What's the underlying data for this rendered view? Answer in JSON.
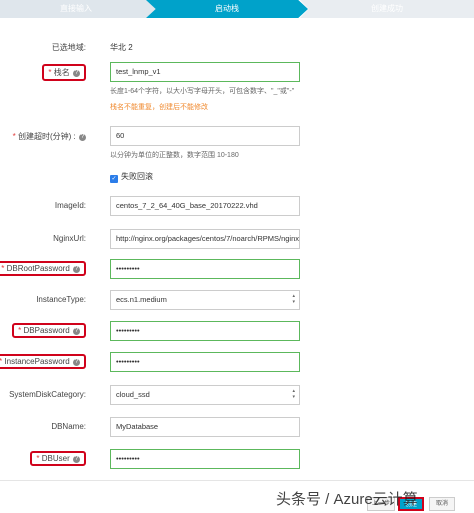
{
  "steps": [
    "直接输入",
    "启动栈",
    "创建成功"
  ],
  "region": {
    "label": "已选地域:",
    "value": "华北 2"
  },
  "stack_name": {
    "label": "栈名",
    "value": "test_lnmp_v1",
    "hint": "长度1-64个字符，以大小写字母开头，可包含数字、\"_\"或\"-\"",
    "warning": "栈名不能重复，创建后不能修改"
  },
  "timeout": {
    "label": "创建超时(分钟)",
    "value": "60",
    "hint": "以分钟为单位的正整数，数字范围 10-180"
  },
  "rollback": {
    "label": "失败回滚",
    "checked": true
  },
  "params": {
    "image_id": {
      "label": "ImageId:",
      "value": "centos_7_2_64_40G_base_20170222.vhd"
    },
    "nginx_url": {
      "label": "NginxUrl:",
      "value": "http://nginx.org/packages/centos/7/noarch/RPMS/nginx"
    },
    "db_root_password": {
      "label": "DBRootPassword",
      "value": "•••••••••"
    },
    "instance_type": {
      "label": "InstanceType:",
      "value": "ecs.n1.medium"
    },
    "db_password": {
      "label": "DBPassword",
      "value": "•••••••••"
    },
    "instance_password": {
      "label": "InstancePassword",
      "value": "•••••••••"
    },
    "system_disk_category": {
      "label": "SystemDiskCategory:",
      "value": "cloud_ssd"
    },
    "db_name": {
      "label": "DBName:",
      "value": "MyDatabase"
    },
    "db_user": {
      "label": "DBUser",
      "value": "•••••••••"
    }
  },
  "buttons": {
    "prev": "上一步",
    "create": "创建",
    "cancel": "取消"
  },
  "watermark": "头条号 / Azure云计算"
}
